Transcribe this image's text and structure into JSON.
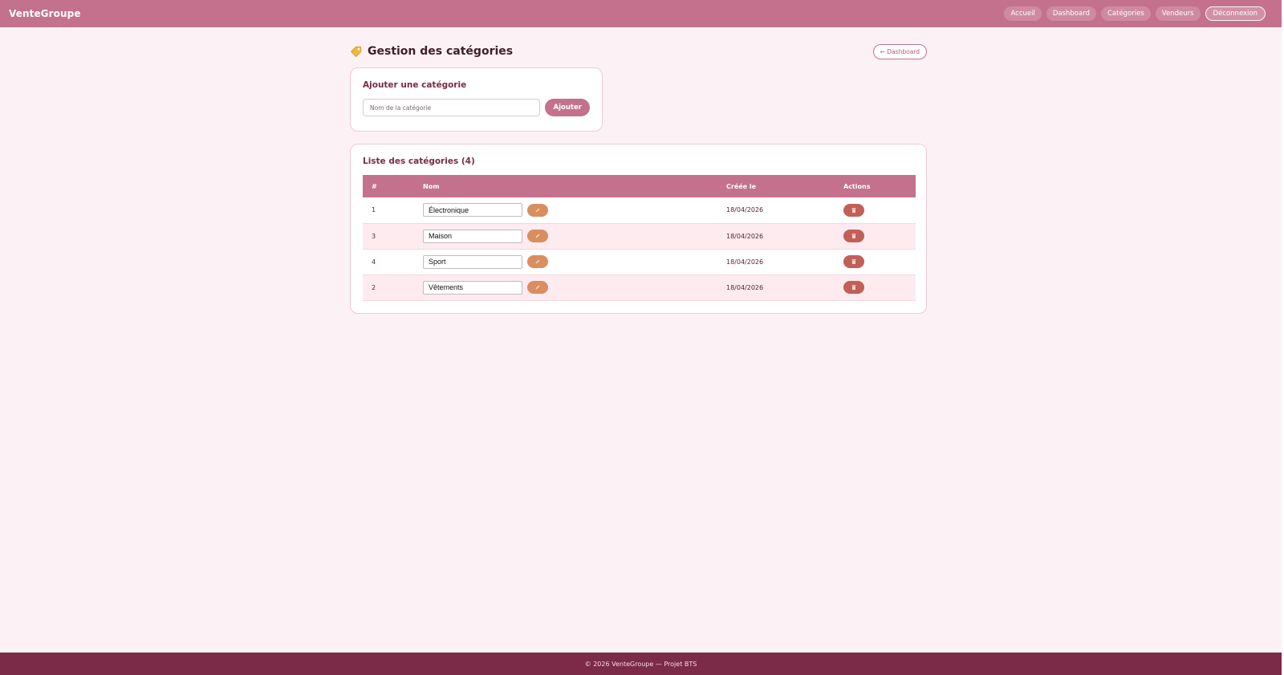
{
  "brand": "VenteGroupe",
  "nav": {
    "links": [
      "Accueil",
      "Dashboard",
      "Catégories",
      "Vendeurs"
    ],
    "logout": "Déconnexion"
  },
  "page": {
    "title": "Gestion des catégories",
    "back_label": "← Dashboard"
  },
  "add_form": {
    "title": "Ajouter une catégorie",
    "placeholder": "Nom de la catégorie",
    "submit_label": "Ajouter"
  },
  "list": {
    "title": "Liste des catégories (4)",
    "columns": [
      "#",
      "Nom",
      "Créée le",
      "Actions"
    ],
    "rows": [
      {
        "id": "1",
        "name": "Électronique",
        "created": "18/04/2026"
      },
      {
        "id": "3",
        "name": "Maison",
        "created": "18/04/2026"
      },
      {
        "id": "4",
        "name": "Sport",
        "created": "18/04/2026"
      },
      {
        "id": "2",
        "name": "Vêtements",
        "created": "18/04/2026"
      }
    ]
  },
  "footer": "© 2026 VenteGroupe — Projet BTS",
  "colors": {
    "primary": "#c4718d",
    "dark": "#7b2a47",
    "background": "#fcf2f5",
    "edit": "#d98e5f",
    "delete": "#c15f58"
  },
  "icons": {
    "title": "tag-icon",
    "edit": "pencil-icon",
    "delete": "trash-icon"
  }
}
